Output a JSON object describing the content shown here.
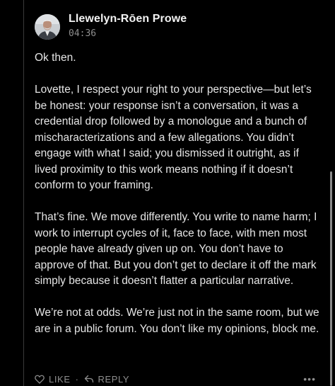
{
  "comment": {
    "author": "Llewelyn-Rōen Prowe",
    "timestamp": "04:36",
    "avatar_icon": "user-avatar",
    "paragraphs": [
      "Ok then.",
      "Lovette, I respect your right to your perspective—but let’s be honest: your response isn’t a conversation, it was a credential drop followed by a monologue and a bunch of mischaracterizations and a few allegations. You didn’t engage with what I said; you dismissed it outright, as if lived proximity to this work means nothing if it doesn’t conform to your framing.",
      "That’s fine. We move differently. You write to name harm; I work to interrupt cycles of it, face to face, with men most people have already given up on. You don’t have to approve of that. But you don’t get to declare it off the mark simply because it doesn’t flatter a particular narrative.",
      "We’re not at odds. We’re just not in the same room, but we are in a public forum. You don’t like my opinions, block me."
    ]
  },
  "actions": {
    "like_label": "LIKE",
    "separator": "·",
    "reply_label": "REPLY",
    "more_label": "•••",
    "like_icon": "heart-icon",
    "reply_icon": "reply-arrow-icon"
  },
  "colors": {
    "background": "#000000",
    "text": "#e6e6e6",
    "muted": "#8e8e8e"
  }
}
